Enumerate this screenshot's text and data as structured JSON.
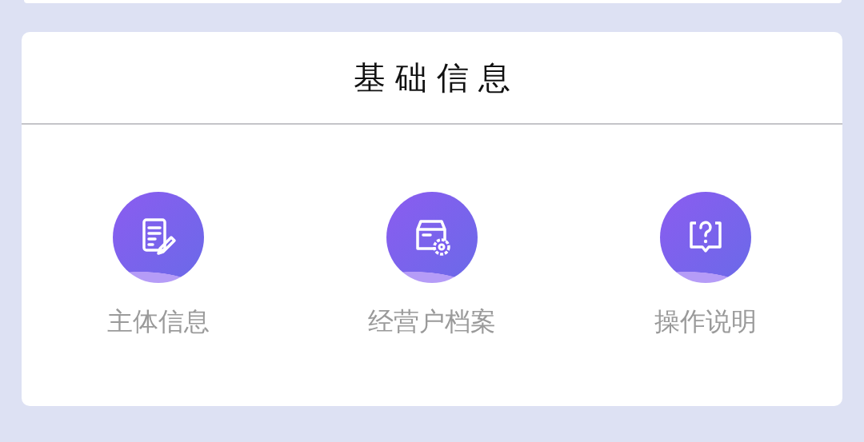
{
  "section": {
    "title": "基础信息"
  },
  "items": [
    {
      "label": "主体信息",
      "kind": "document"
    },
    {
      "label": "经营户档案",
      "kind": "box"
    },
    {
      "label": "操作说明",
      "kind": "help"
    }
  ]
}
